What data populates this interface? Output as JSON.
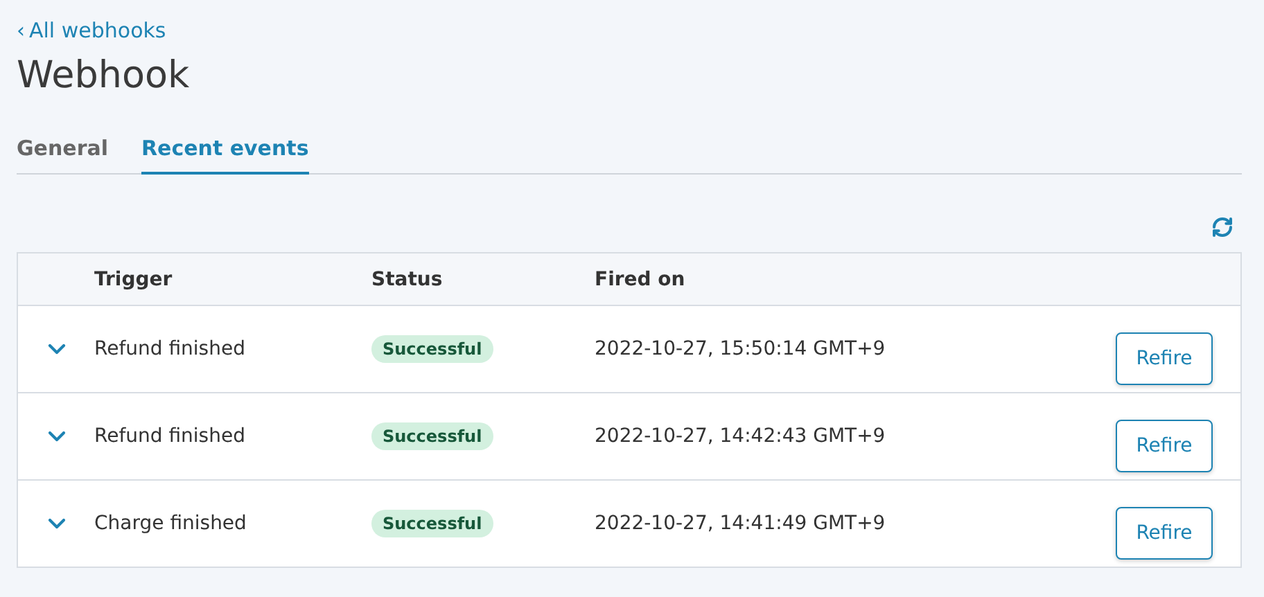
{
  "back_link": {
    "arrow": "‹",
    "label": "All webhooks"
  },
  "title": "Webhook",
  "tabs": [
    {
      "label": "General",
      "selected": false
    },
    {
      "label": "Recent events",
      "selected": true
    }
  ],
  "table": {
    "columns": [
      "Trigger",
      "Status",
      "Fired on"
    ],
    "rows": [
      {
        "expanded": false,
        "trigger": "Refund finished",
        "status": {
          "label": "Successful",
          "kind": "success"
        },
        "fired_on": "2022-10-27, 15:50:14 GMT+9",
        "action": "Refire"
      },
      {
        "expanded": false,
        "trigger": "Refund finished",
        "status": {
          "label": "Successful",
          "kind": "success"
        },
        "fired_on": "2022-10-27, 14:42:43 GMT+9",
        "action": "Refire"
      },
      {
        "expanded": false,
        "trigger": "Charge finished",
        "status": {
          "label": "Successful",
          "kind": "success"
        },
        "fired_on": "2022-10-27, 14:41:49 GMT+9",
        "action": "Refire"
      }
    ]
  }
}
